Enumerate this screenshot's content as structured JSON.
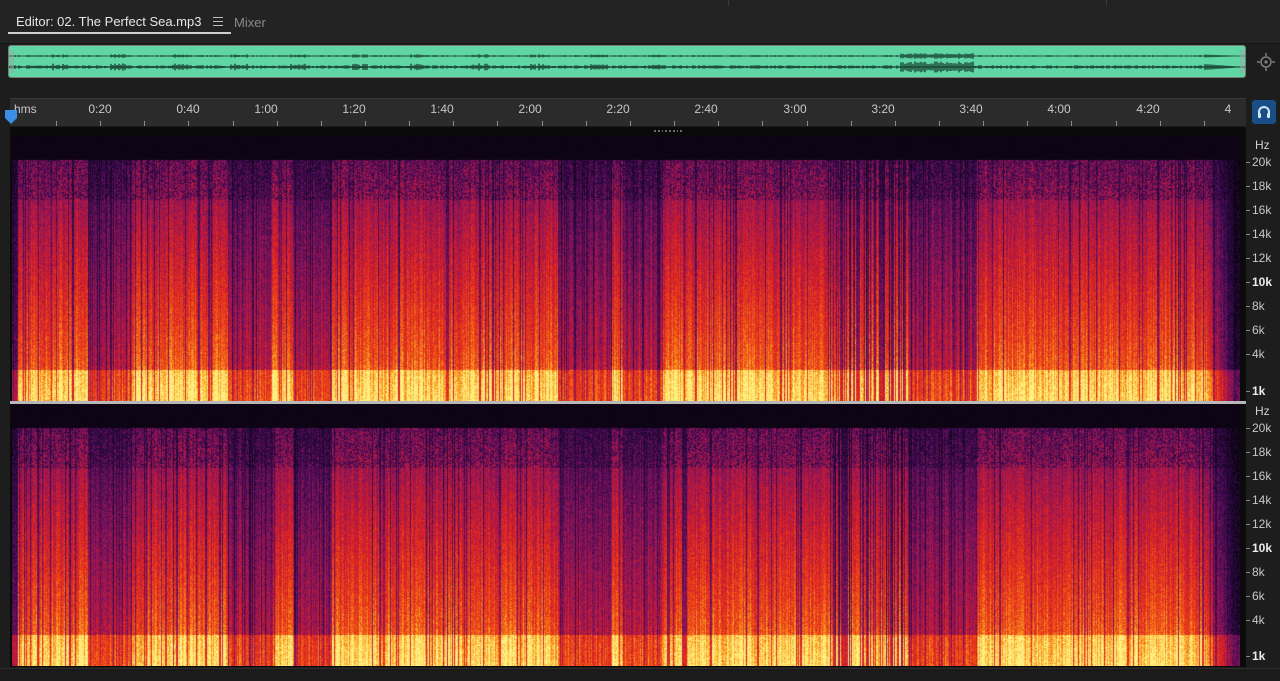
{
  "tabs": {
    "editor_label": "Editor: 02. The Perfect Sea.mp3",
    "mixer_label": "Mixer"
  },
  "icons": {
    "tab_menu": "hamburger-icon",
    "zoom": "zoom-target-icon",
    "playhead": "playhead-marker-icon",
    "snap": "headphones-icon"
  },
  "colors": {
    "overview_wave_bg": "#5fd6a3",
    "snap_button": "#1a4f86",
    "playhead": "#3a8ee6"
  },
  "ruler": {
    "unit_label": "hms",
    "labels": [
      "0:20",
      "0:40",
      "1:00",
      "1:20",
      "1:40",
      "2:00",
      "2:20",
      "2:40",
      "3:00",
      "3:20",
      "3:40",
      "4:00",
      "4:20",
      "4"
    ]
  },
  "spectrogram": {
    "channels": [
      {
        "unit": "Hz",
        "labels": [
          "20k",
          "18k",
          "16k",
          "14k",
          "12k",
          "10k",
          "8k",
          "6k",
          "4k",
          "1k"
        ]
      },
      {
        "unit": "Hz",
        "labels": [
          "20k",
          "18k",
          "16k",
          "14k",
          "12k",
          "10k",
          "8k",
          "6k",
          "4k",
          "1k"
        ]
      }
    ]
  }
}
